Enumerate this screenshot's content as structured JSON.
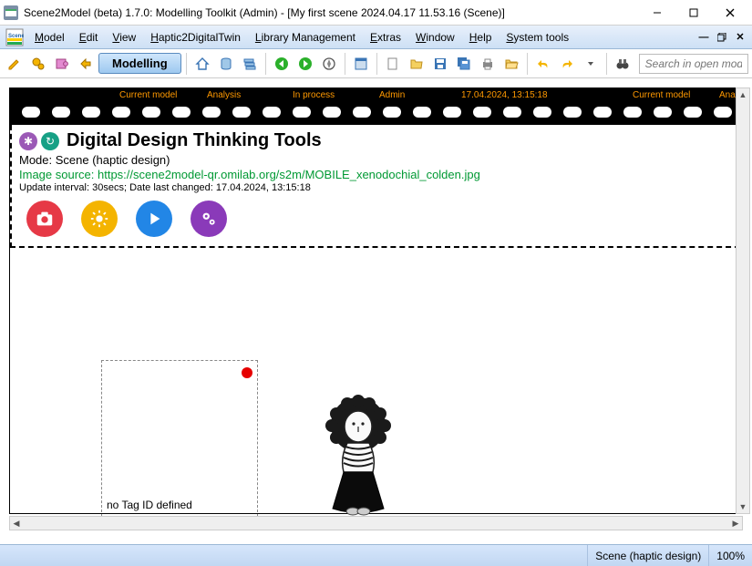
{
  "title": "Scene2Model (beta) 1.7.0: Modelling Toolkit (Admin) - [My first scene 2024.04.17 11.53.16 (Scene)]",
  "menu": {
    "items": [
      "Model",
      "Edit",
      "View",
      "Haptic2DigitalTwin",
      "Library Management",
      "Extras",
      "Window",
      "Help",
      "System tools"
    ]
  },
  "toolbar": {
    "modelling_label": "Modelling",
    "search_placeholder": "Search in open models"
  },
  "filmstrip": {
    "labels": [
      "Current model",
      "Analysis",
      "In process",
      "Admin",
      "17.04.2024, 13:15:18",
      "Current model",
      "Analy"
    ]
  },
  "header": {
    "title": "Digital Design Thinking Tools",
    "mode": "Mode: Scene (haptic design)",
    "source": "Image source: https://scene2model-qr.omilab.org/s2m/MOBILE_xenodochial_colden.jpg",
    "update": "Update interval: 30secs; Date last changed: 17.04.2024, 13:15:18"
  },
  "tagbox": {
    "label": "no Tag ID defined"
  },
  "status": {
    "mode": "Scene (haptic design)",
    "zoom": "100%"
  },
  "colors": {
    "action_red": "#e63946",
    "action_yellow": "#f4b400",
    "action_blue": "#2286e6",
    "action_purple": "#8a3ab9",
    "icon_purple": "#9b59b6",
    "icon_teal": "#16a085"
  }
}
